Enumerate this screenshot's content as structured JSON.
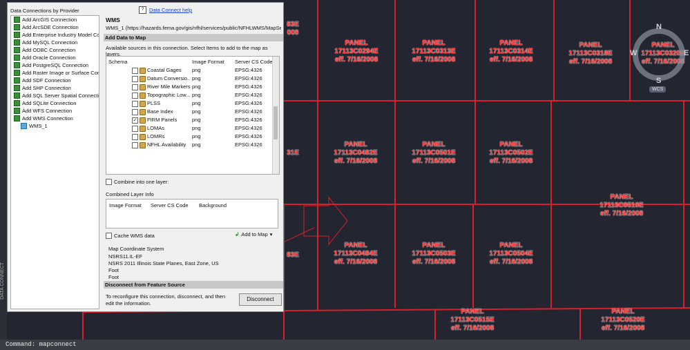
{
  "command_line": "Command:  mapconnect",
  "side_strip_label": "DATA CONNECT",
  "dialog": {
    "providers_title": "Data Connections by Provider",
    "help_link": "Data Connect help",
    "providers": [
      "Add ArcGIS Connection",
      "Add ArcSDE Connection",
      "Add Enterprise Industry Model Co",
      "Add MySQL Connection",
      "Add ODBC Connection",
      "Add Oracle Connection",
      "Add PostgreSQL Connection",
      "Add Raster Image or Surface Con",
      "Add SDF Connection",
      "Add SHP Connection",
      "Add SQL Server Spatial Connectio",
      "Add SQLite Connection",
      "Add WFS Connection",
      "Add WMS Connection"
    ],
    "sub_item": "WMS_1",
    "wms_title": "WMS",
    "wms_url": "WMS_1  (https://hazards.fema.gov/gis/nfhl/services/public/NFHLWMS/MapServer/W",
    "add_data_section": "Add Data to Map",
    "available_text": "Available sources in this connection.  Select Items to add to the map as layers.",
    "columns": {
      "schema": "Schema",
      "format": "Image Format",
      "cs": "Server CS Code"
    },
    "layers": [
      {
        "name": "Coastal Gages",
        "format": "png",
        "cs": "EPSG:4326",
        "checked": false
      },
      {
        "name": "Datum Conversio...",
        "format": "png",
        "cs": "EPSG:4326",
        "checked": false
      },
      {
        "name": "River Mile Markers",
        "format": "png",
        "cs": "EPSG:4326",
        "checked": false
      },
      {
        "name": "Topographic Low...",
        "format": "png",
        "cs": "EPSG:4326",
        "checked": false
      },
      {
        "name": "PLSS",
        "format": "png",
        "cs": "EPSG:4326",
        "checked": false
      },
      {
        "name": "Base Index",
        "format": "png",
        "cs": "EPSG:4326",
        "checked": false
      },
      {
        "name": "FIRM Panels",
        "format": "png",
        "cs": "EPSG:4326",
        "checked": true
      },
      {
        "name": "LOMAs",
        "format": "png",
        "cs": "EPSG:4326",
        "checked": false
      },
      {
        "name": "LOMRs",
        "format": "png",
        "cs": "EPSG:4326",
        "checked": false
      },
      {
        "name": "NFHL Availability",
        "format": "png",
        "cs": "EPSG:4326",
        "checked": false
      }
    ],
    "checkmark": "✓",
    "combine_label": "Combine into one layer:",
    "combined_title": "Combined Layer Info",
    "combined_cols": {
      "format": "Image Format",
      "cs": "Server CS Code",
      "bg": "Background"
    },
    "cache_label": "Cache WMS data",
    "add_to_map": "Add to Map",
    "mcs_title": "Map Coordinate System",
    "mcs_code": "NSRS11.IL-EF",
    "mcs_desc": "NSRS 2011 Illinois State Planes, East Zone, US Foot",
    "mcs_unit": "Foot",
    "disconnect_section": "Disconnect from Feature Source",
    "disconnect_text": "To reconfigure this connection, disconnect, and then edit the information.",
    "disconnect_button": "Disconnect"
  },
  "map": {
    "panels": [
      {
        "word": "PANEL",
        "code": "17113C0294E",
        "eff": "eff. 7/16/2008"
      },
      {
        "word": "PANEL",
        "code": "17113C0313E",
        "eff": "eff. 7/16/2008"
      },
      {
        "word": "PANEL",
        "code": "17113C0314E",
        "eff": "eff. 7/16/2008"
      },
      {
        "word": "PANEL",
        "code": "17113C0318E",
        "eff": "eff. 7/16/2008"
      },
      {
        "word": "PANEL",
        "code": "17113C0320E",
        "eff": "eff. 7/16/2008"
      },
      {
        "word": "PANEL",
        "code": "17113C0482E",
        "eff": "eff. 7/16/2008"
      },
      {
        "word": "PANEL",
        "code": "17113C0501E",
        "eff": "eff. 7/16/2008"
      },
      {
        "word": "PANEL",
        "code": "17113C0502E",
        "eff": "eff. 7/16/2008"
      },
      {
        "word": "PANEL",
        "code": "17113C0510E",
        "eff": "eff. 7/16/2008"
      },
      {
        "word": "PANEL",
        "code": "17113C0484E",
        "eff": "eff. 7/16/2008"
      },
      {
        "word": "PANEL",
        "code": "17113C0503E",
        "eff": "eff. 7/16/2008"
      },
      {
        "word": "PANEL",
        "code": "17113C0504E",
        "eff": "eff. 7/16/2008"
      },
      {
        "word": "PANEL",
        "code": "17113C0515E",
        "eff": "eff. 7/16/2008"
      },
      {
        "word": "PANEL",
        "code": "17113C0520E",
        "eff": "eff. 7/16/2008"
      }
    ],
    "partial_labels": [
      "83E",
      "008",
      "31E",
      "83E"
    ],
    "compass": {
      "n": "N",
      "s": "S",
      "e": "E",
      "w": "W"
    },
    "wcs_label": "WCS"
  },
  "colors": {
    "panel_red": "#ff2b2b",
    "grid_red": "#d8202a",
    "annotation_red": "#d8202a"
  }
}
